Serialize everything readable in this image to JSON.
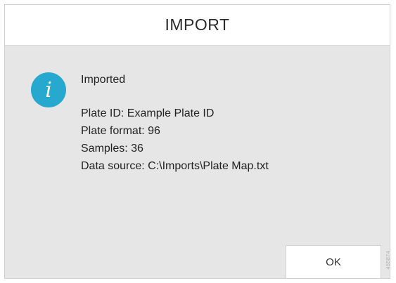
{
  "dialog": {
    "title": "IMPORT",
    "icon": "info-icon",
    "icon_glyph": "i",
    "icon_color": "#27a9cf",
    "heading": "Imported",
    "details": [
      "Plate ID: Example Plate ID",
      "Plate format: 96",
      "Samples: 36",
      "Data source: C:\\Imports\\Plate Map.txt"
    ],
    "ok_label": "OK"
  },
  "watermark": "455874"
}
